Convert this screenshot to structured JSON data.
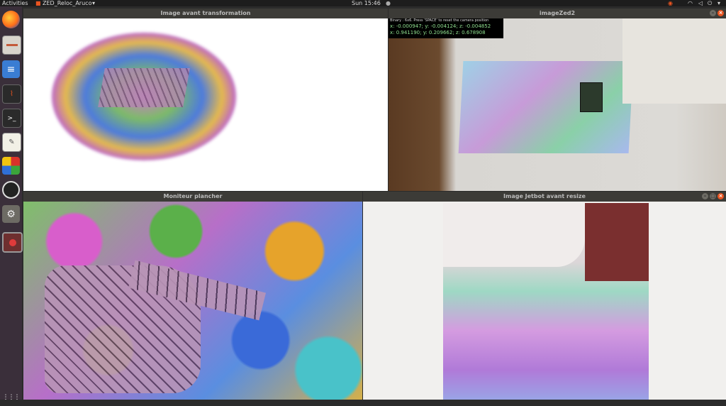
{
  "topbar": {
    "activities": "Activities",
    "app_name": "ZED_Reloc_Aruco",
    "app_dropdown": "▾",
    "clock": "Sun 15:46",
    "clock_indicator": "●"
  },
  "dock": {
    "items": [
      {
        "name": "firefox-icon"
      },
      {
        "name": "files-icon"
      },
      {
        "name": "document-viewer-icon"
      },
      {
        "name": "system-monitor-icon"
      },
      {
        "name": "terminal-icon"
      },
      {
        "name": "text-editor-icon"
      },
      {
        "name": "app-icon"
      },
      {
        "name": "obs-icon"
      },
      {
        "name": "settings-icon"
      },
      {
        "name": "recorder-icon"
      }
    ],
    "show_apps": "⋮⋮⋮"
  },
  "windows": {
    "transform": {
      "title": "Image avant transformation"
    },
    "zed": {
      "title": "imageZed2",
      "overlay_line1": "Binary : 6x6.    Press 'SPACE' to reset the camera position",
      "overlay_line2": "x: -0.000947; y: -0.004124; z: -0.004852",
      "overlay_line3": "x: 0.941190; y: 0.209662; z: 0.678908"
    },
    "moniteur": {
      "title": "Moniteur plancher"
    },
    "jetbot": {
      "title": "Image Jetbot avant resize"
    }
  },
  "colors": {
    "accent": "#e95420",
    "topbar": "#1d1d1d",
    "dock": "#3a2f3a",
    "titlebar": "#3c3b37"
  }
}
